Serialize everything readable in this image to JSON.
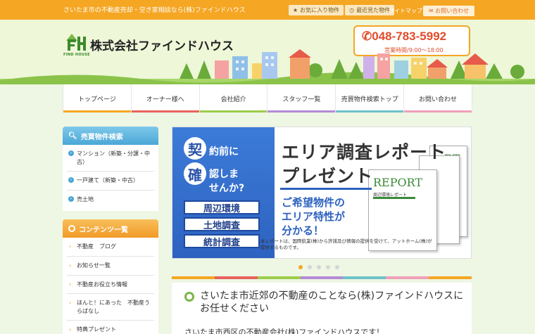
{
  "topbar": {
    "tagline": "さいたま市の不動産売却・空き家相談なら(株)ファインドハウス",
    "favorites": "お気に入り物件",
    "recent": "最近見た物件",
    "sitemap": "サイトマップ",
    "contact": "お問い合わせ"
  },
  "header": {
    "logo_sub": "FIND HOUSE",
    "company": "株式会社ファインドハウス",
    "phone": "048-783-5992",
    "hours": "営業時間/9:00～18:00"
  },
  "nav": [
    {
      "label": "トップページ",
      "color": "#f5a623"
    },
    {
      "label": "オーナー様へ",
      "color": "#e8625c"
    },
    {
      "label": "会社紹介",
      "color": "#9ccc4a"
    },
    {
      "label": "スタッフ一覧",
      "color": "#b48ad6"
    },
    {
      "label": "売買物件検索トップ",
      "color": "#6cc3c8"
    },
    {
      "label": "お問い合わせ",
      "color": "#f0a0b8"
    }
  ],
  "sidebar": {
    "search_title": "売買物件検索",
    "search_items": [
      "マンション（新築・分譲・中古）",
      "一戸建て（新築・中古）",
      "売土地"
    ],
    "contents_title": "コンテンツ一覧",
    "contents_items": [
      "不動産　ブログ",
      "お知らせ一覧",
      "不動産お役立ち情報",
      "ほんと！にあった　不動産うらばなし",
      "特典プレゼント"
    ]
  },
  "banner": {
    "kanji1": "契",
    "text1": "約前に",
    "kanji2": "確",
    "text2a": "認しま",
    "text2b": "せんか?",
    "btn1": "周辺環境",
    "btn2": "土地調査",
    "btn3": "統計調査",
    "title1": "エリア調査レポート",
    "title2": "プレゼント",
    "sub1": "ご希望物件の",
    "sub2": "エリア特性が",
    "sub3": "分かる！",
    "note": "本レポートは、国際航業(株)から許諾及び情報の提供を受けて、アットホーム(株)が提供するものです。",
    "report_big": "REPORT",
    "report_sub": "周辺環境レポート",
    "report_small": "RT"
  },
  "slider": {
    "count": 5,
    "active": 0
  },
  "rainbow": [
    "#f5a623",
    "#e8625c",
    "#9ccc4a",
    "#b48ad6",
    "#6cc3c8",
    "#f0a0b8",
    "#f5a623"
  ],
  "main": {
    "title": "さいたま市近郊の不動産のことなら(株)ファインドハウスにお任せください",
    "text": "さいたま市西区の不動産会社(株)ファインドハウスです！"
  },
  "colors": {
    "accent": "#f5a623",
    "phone": "#e14d2a",
    "blue": "#2e62c0",
    "green": "#7ab648"
  }
}
